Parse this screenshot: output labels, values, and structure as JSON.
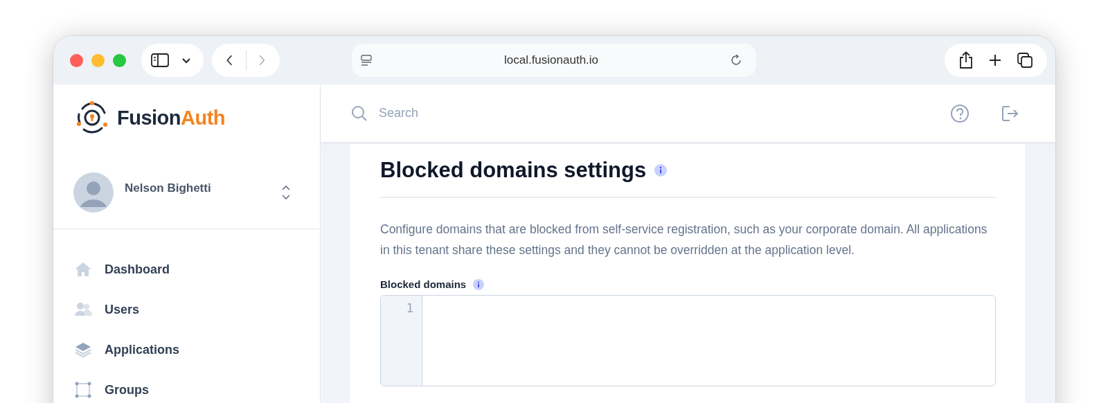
{
  "browser": {
    "url": "local.fusionauth.io"
  },
  "logo": {
    "primary": "Fusion",
    "accent": "Auth"
  },
  "user": {
    "name": "Nelson Bighetti"
  },
  "nav": [
    {
      "kind": "home",
      "label": "Dashboard"
    },
    {
      "kind": "users",
      "label": "Users"
    },
    {
      "kind": "layers",
      "label": "Applications"
    },
    {
      "kind": "groups",
      "label": "Groups"
    }
  ],
  "search": {
    "placeholder": "Search"
  },
  "section": {
    "title": "Blocked domains settings",
    "description": "Configure domains that are blocked from self-service registration, such as your corporate domain. All applications in this tenant share these settings and they cannot be overridden at the application level.",
    "field_label": "Blocked domains",
    "line_numbers": [
      "1"
    ]
  }
}
